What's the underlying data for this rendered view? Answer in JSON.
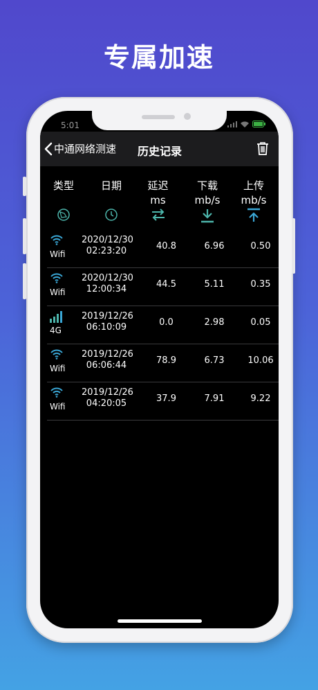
{
  "headline": "专属加速",
  "status": {
    "time": "5:01"
  },
  "nav": {
    "back_label": "中通网络测速",
    "title": "历史记录"
  },
  "columns": [
    {
      "label": "类型",
      "unit": ""
    },
    {
      "label": "日期",
      "unit": ""
    },
    {
      "label": "延迟",
      "unit": "ms"
    },
    {
      "label": "下载",
      "unit": "mb/s"
    },
    {
      "label": "上传",
      "unit": "mb/s"
    }
  ],
  "rows": [
    {
      "type": "Wifi",
      "date": "2020/12/30",
      "time": "02:23:20",
      "latency": "40.8",
      "download": "6.96",
      "upload": "0.50",
      "icon": "wifi-icon"
    },
    {
      "type": "Wifi",
      "date": "2020/12/30",
      "time": "12:00:34",
      "latency": "44.5",
      "download": "5.11",
      "upload": "0.35",
      "icon": "wifi-icon"
    },
    {
      "type": "4G",
      "date": "2019/12/26",
      "time": "06:10:09",
      "latency": "0.0",
      "download": "2.98",
      "upload": "0.05",
      "icon": "cellular-signal-icon"
    },
    {
      "type": "Wifi",
      "date": "2019/12/26",
      "time": "06:06:44",
      "latency": "78.9",
      "download": "6.73",
      "upload": "10.06",
      "icon": "wifi-icon"
    },
    {
      "type": "Wifi",
      "date": "2019/12/26",
      "time": "04:20:05",
      "latency": "37.9",
      "download": "7.91",
      "upload": "9.22",
      "icon": "wifi-icon"
    }
  ],
  "colors": {
    "accent": "#3aa7d6",
    "teal": "#4db6ac",
    "background": "#000000"
  }
}
